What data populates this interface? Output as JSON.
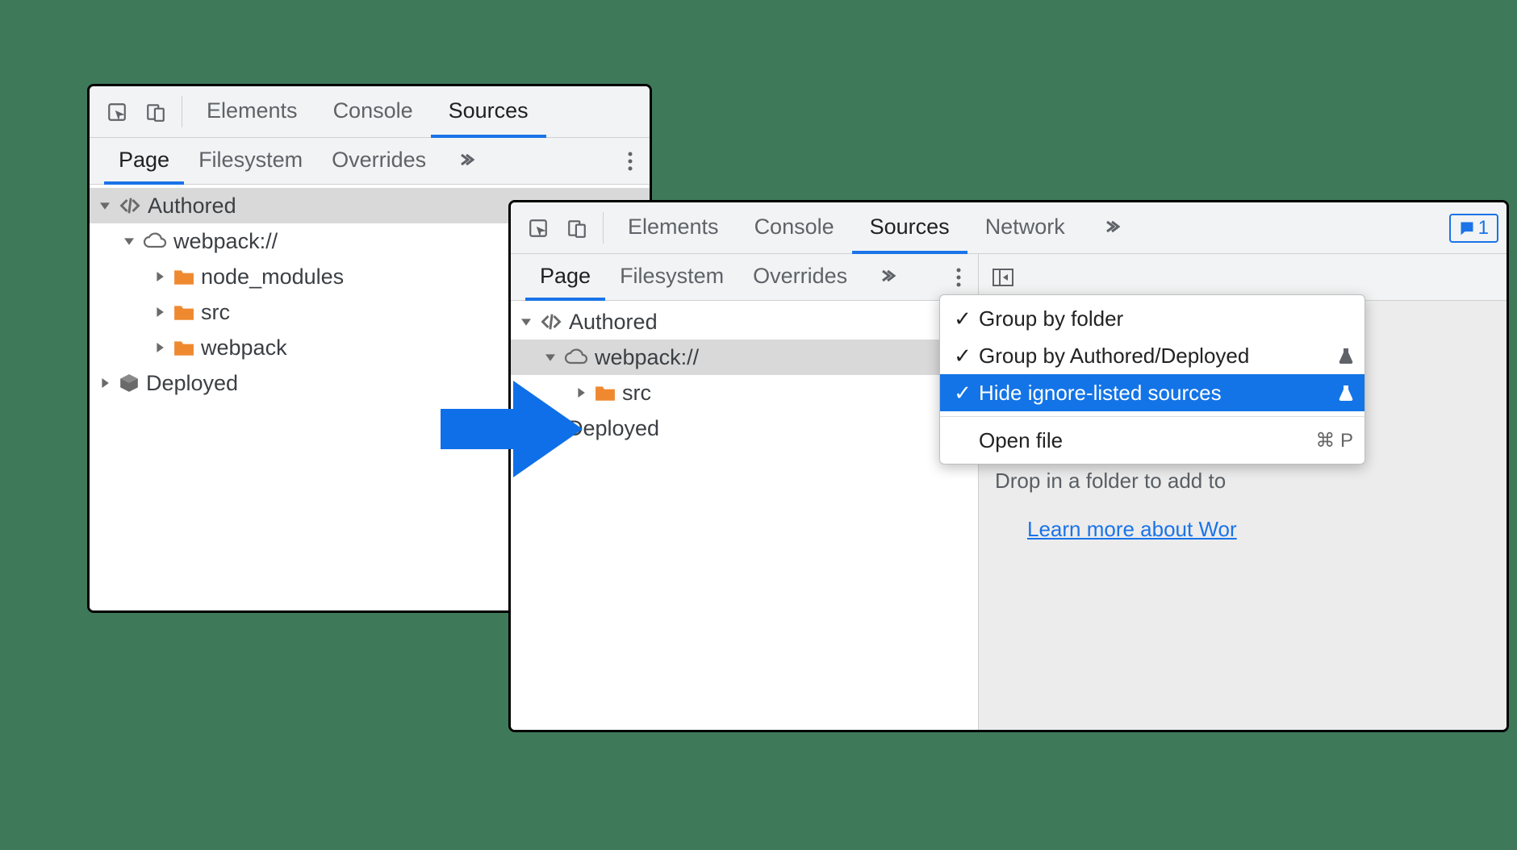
{
  "left_window": {
    "main_tabs": {
      "elements": "Elements",
      "console": "Console",
      "sources": "Sources"
    },
    "sub_tabs": {
      "page": "Page",
      "filesystem": "Filesystem",
      "overrides": "Overrides"
    },
    "tree": {
      "authored": "Authored",
      "webpack": "webpack://",
      "node_modules": "node_modules",
      "src": "src",
      "webpack_folder": "webpack",
      "deployed": "Deployed"
    }
  },
  "right_window": {
    "main_tabs": {
      "elements": "Elements",
      "console": "Console",
      "sources": "Sources",
      "network": "Network"
    },
    "info_badge": "1",
    "sub_tabs": {
      "page": "Page",
      "filesystem": "Filesystem",
      "overrides": "Overrides"
    },
    "tree": {
      "authored": "Authored",
      "webpack": "webpack://",
      "src": "src",
      "deployed": "Deployed"
    },
    "pane": {
      "drop_msg": "Drop in a folder to add to",
      "learn_link": "Learn more about Wor"
    },
    "menu": {
      "group_by_folder": "Group by folder",
      "group_by_authored": "Group by Authored/Deployed",
      "hide_ignore": "Hide ignore-listed sources",
      "open_file": "Open file",
      "open_file_shortcut": "⌘ P"
    }
  }
}
